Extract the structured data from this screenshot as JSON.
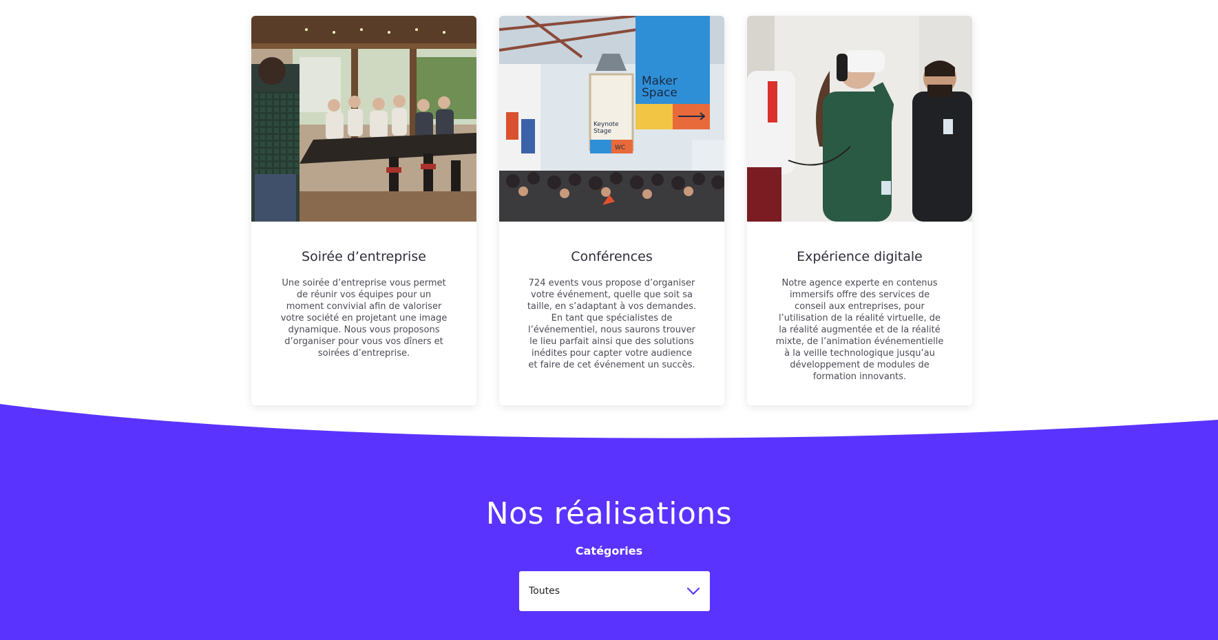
{
  "cards": [
    {
      "title": "Soirée d’entreprise",
      "text": "Une soirée d’entreprise vous permet de réunir vos équipes pour un moment convivial afin de valoriser votre société en projetant une image dynamique. Nous vous proposons d’organiser pour vous vos dîners et soirées d’entreprise.",
      "image": "company-dinner-photo"
    },
    {
      "title": "Conférences",
      "text": "724 events vous propose d’organiser votre événement, quelle que soit sa taille, en s’adaptant à vos demandes. En tant que spécialistes de l’événementiel, nous saurons trouver le lieu parfait ainsi que des solutions inédites pour capter votre audience et faire de cet événement un succès.",
      "image": "conference-hall-photo",
      "image_signs": {
        "maker": "Maker",
        "space": "Space",
        "keynote": "Keynote",
        "stage": "Stage",
        "wc": "WC"
      }
    },
    {
      "title": "Expérience digitale",
      "text": "Notre agence experte en contenus immersifs offre des services de conseil aux entreprises, pour l’utilisation de la réalité virtuelle, de la réalité augmentée et de la réalité mixte, de l’animation événementielle à la veille technologique jusqu’au développement de modules de formation innovants.",
      "image": "vr-headset-photo"
    }
  ],
  "realisations": {
    "title": "Nos réalisations",
    "filter_label": "Catégories",
    "selected_category": "Toutes"
  },
  "colors": {
    "accent": "#5b33ff",
    "text_dark": "#2d2d3a",
    "white": "#ffffff"
  },
  "icons": {
    "select_arrow": "chevron-down-icon"
  }
}
